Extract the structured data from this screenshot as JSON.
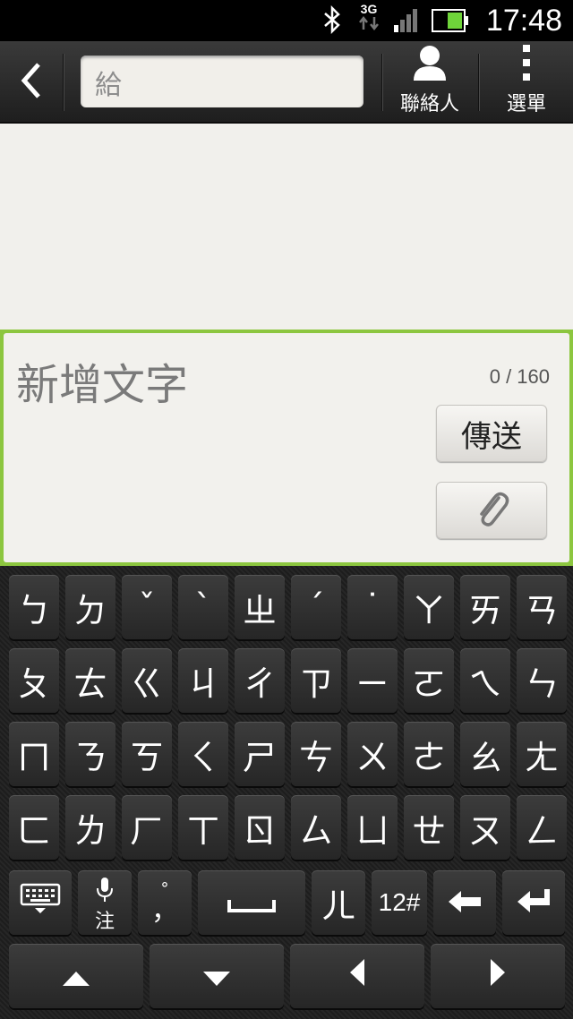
{
  "status_bar": {
    "time": "17:48",
    "network": "3G"
  },
  "top_bar": {
    "to_placeholder": "給",
    "contacts_label": "聯絡人",
    "menu_label": "選單"
  },
  "compose": {
    "placeholder": "新增文字",
    "counter": "0 / 160",
    "send_label": "傳送"
  },
  "keyboard": {
    "rows": [
      [
        "ㄅ",
        "ㄉ",
        "ˇ",
        "ˋ",
        "ㄓ",
        "ˊ",
        "˙",
        "ㄚ",
        "ㄞ",
        "ㄢ"
      ],
      [
        "ㄆ",
        "ㄊ",
        "ㄍ",
        "ㄐ",
        "ㄔ",
        "ㄗ",
        "ㄧ",
        "ㄛ",
        "ㄟ",
        "ㄣ"
      ],
      [
        "ㄇ",
        "ㄋ",
        "ㄎ",
        "ㄑ",
        "ㄕ",
        "ㄘ",
        "ㄨ",
        "ㄜ",
        "ㄠ",
        "ㄤ"
      ],
      [
        "ㄈ",
        "ㄌ",
        "ㄏ",
        "ㄒ",
        "ㄖ",
        "ㄙ",
        "ㄩ",
        "ㄝ",
        "ㄡ",
        "ㄥ"
      ]
    ],
    "bottom_row": {
      "mic_sub": "注",
      "punct_top": "°",
      "punct_main": "，",
      "space": "␣",
      "er": "ㄦ",
      "numbers": "12#"
    }
  },
  "colors": {
    "accent": "#8cc63f",
    "key_bg": "#333333",
    "bar_bg": "#2a2a2a"
  }
}
